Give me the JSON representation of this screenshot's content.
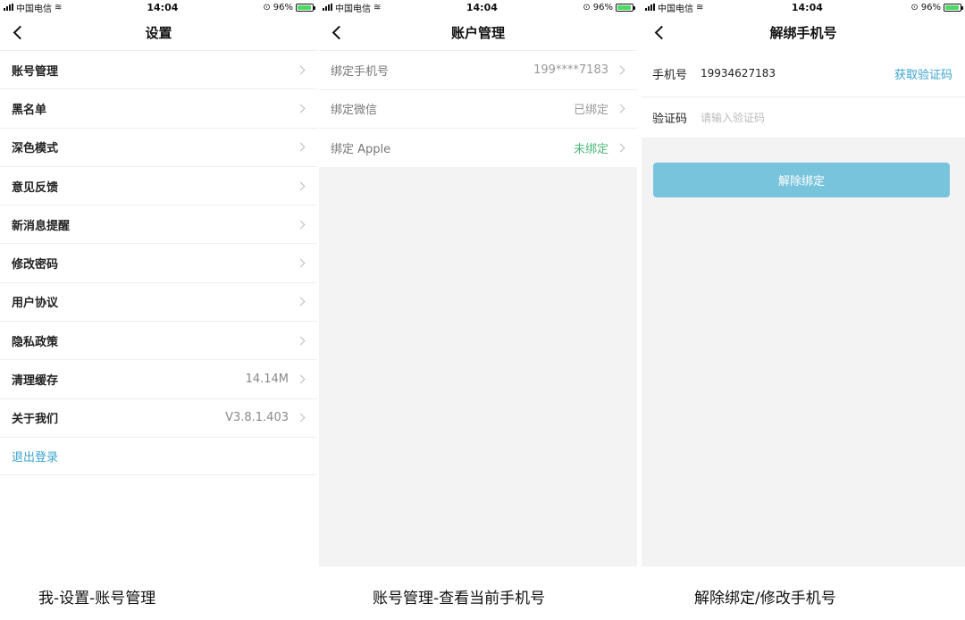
{
  "status": {
    "carrier": "中国电信",
    "time": "14:04",
    "battery": "96%",
    "battery_level": 0.96
  },
  "screen1": {
    "title": "设置",
    "items": [
      {
        "label": "账号管理",
        "value": ""
      },
      {
        "label": "黑名单",
        "value": ""
      },
      {
        "label": "深色模式",
        "value": ""
      },
      {
        "label": "意见反馈",
        "value": ""
      },
      {
        "label": "新消息提醒",
        "value": ""
      },
      {
        "label": "修改密码",
        "value": ""
      },
      {
        "label": "用户协议",
        "value": ""
      },
      {
        "label": "隐私政策",
        "value": ""
      },
      {
        "label": "清理缓存",
        "value": "14.14M"
      },
      {
        "label": "关于我们",
        "value": "V3.8.1.403"
      }
    ],
    "logout": "退出登录"
  },
  "screen2": {
    "title": "账户管理",
    "items": [
      {
        "label": "绑定手机号",
        "value": "199****7183"
      },
      {
        "label": "绑定微信",
        "value": "已绑定"
      },
      {
        "label": "绑定 Apple",
        "value": "未绑定"
      }
    ],
    "status_colors": {
      "unbound": "#4cb87a"
    }
  },
  "screen3": {
    "title": "解绑手机号",
    "phone_label": "手机号",
    "phone_value": "19934627183",
    "get_code": "获取验证码",
    "code_label": "验证码",
    "code_placeholder": "请输入验证码",
    "unbind_button": "解除绑定",
    "accent_color": "#3aa3cf",
    "button_color": "#79c4dd"
  },
  "captions": [
    "我-设置-账号管理",
    "账号管理-查看当前手机号",
    "解除绑定/修改手机号"
  ]
}
